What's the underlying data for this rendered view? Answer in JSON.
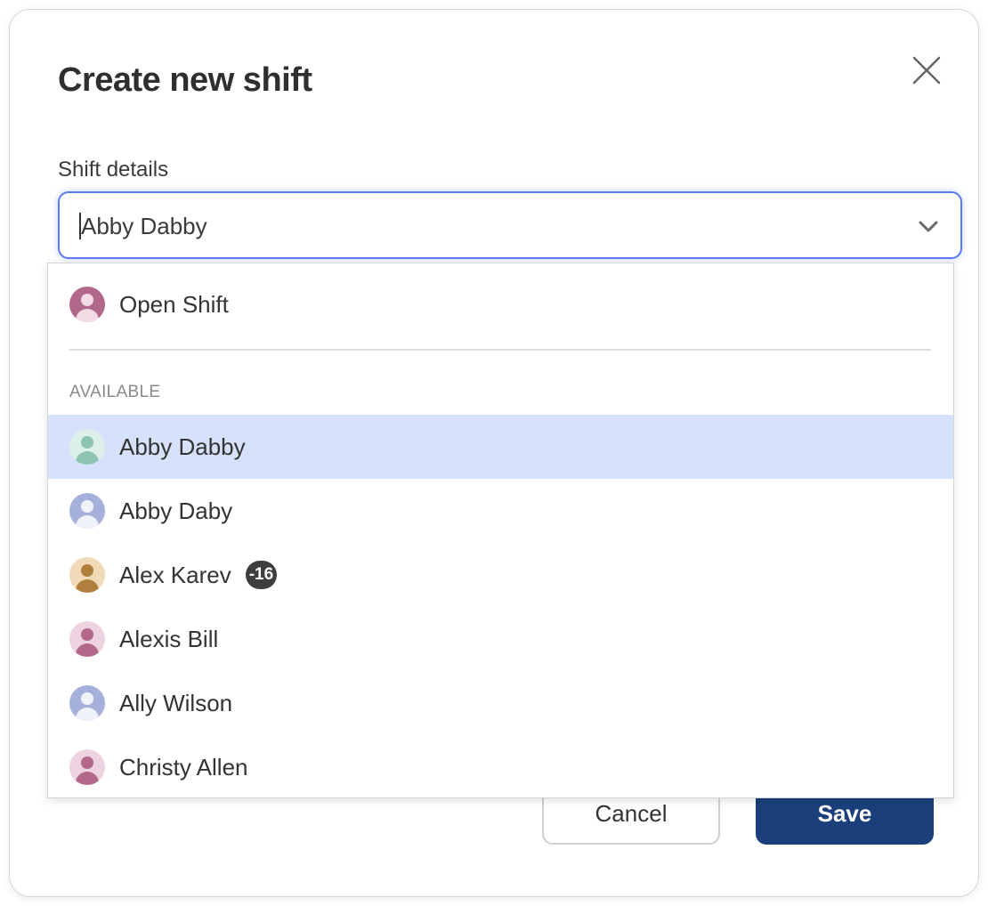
{
  "modal": {
    "title": "Create new shift",
    "section_label": "Shift details",
    "selected_value": "Abby Dabby"
  },
  "footer": {
    "cancel_label": "Cancel",
    "save_label": "Save"
  },
  "dropdown": {
    "open_shift": {
      "label": "Open Shift",
      "avatar_bg": "#b1688a",
      "avatar_fg": "#f2dbe5"
    },
    "group_label": "AVAILABLE",
    "options": [
      {
        "label": "Abby Dabby",
        "badge": null,
        "selected": true,
        "avatar_bg": "#dcefe9",
        "avatar_fg": "#8cc3b2"
      },
      {
        "label": "Abby Daby",
        "badge": null,
        "selected": false,
        "avatar_bg": "#a5b1db",
        "avatar_fg": "#f0f2fa"
      },
      {
        "label": "Alex Karev",
        "badge": "-16",
        "selected": false,
        "avatar_bg": "#f0dab8",
        "avatar_fg": "#b07f3e"
      },
      {
        "label": "Alexis Bill",
        "badge": null,
        "selected": false,
        "avatar_bg": "#ecd3df",
        "avatar_fg": "#b1688a"
      },
      {
        "label": "Ally Wilson",
        "badge": null,
        "selected": false,
        "avatar_bg": "#a5b1db",
        "avatar_fg": "#f0f2fa"
      },
      {
        "label": "Christy Allen",
        "badge": null,
        "selected": false,
        "avatar_bg": "#ecd3df",
        "avatar_fg": "#b1688a"
      }
    ]
  },
  "colors": {
    "accent": "#5b7bf0",
    "selected_row": "#d6e2fb",
    "save_button": "#1b3f7a"
  },
  "icons": {
    "close": "close-icon",
    "dropdown": "chevron-down-icon",
    "avatar": "person-icon"
  }
}
